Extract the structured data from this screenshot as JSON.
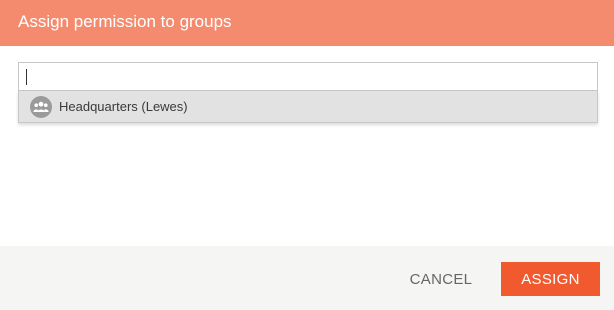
{
  "dialog": {
    "title": "Assign permission to groups",
    "header_color": "#f58b6e"
  },
  "search": {
    "value": "",
    "placeholder": ""
  },
  "results": [
    {
      "label": "Headquarters (Lewes)",
      "icon": "group-icon"
    }
  ],
  "footer": {
    "cancel_label": "CANCEL",
    "assign_label": "ASSIGN",
    "assign_color": "#f15a2e"
  }
}
